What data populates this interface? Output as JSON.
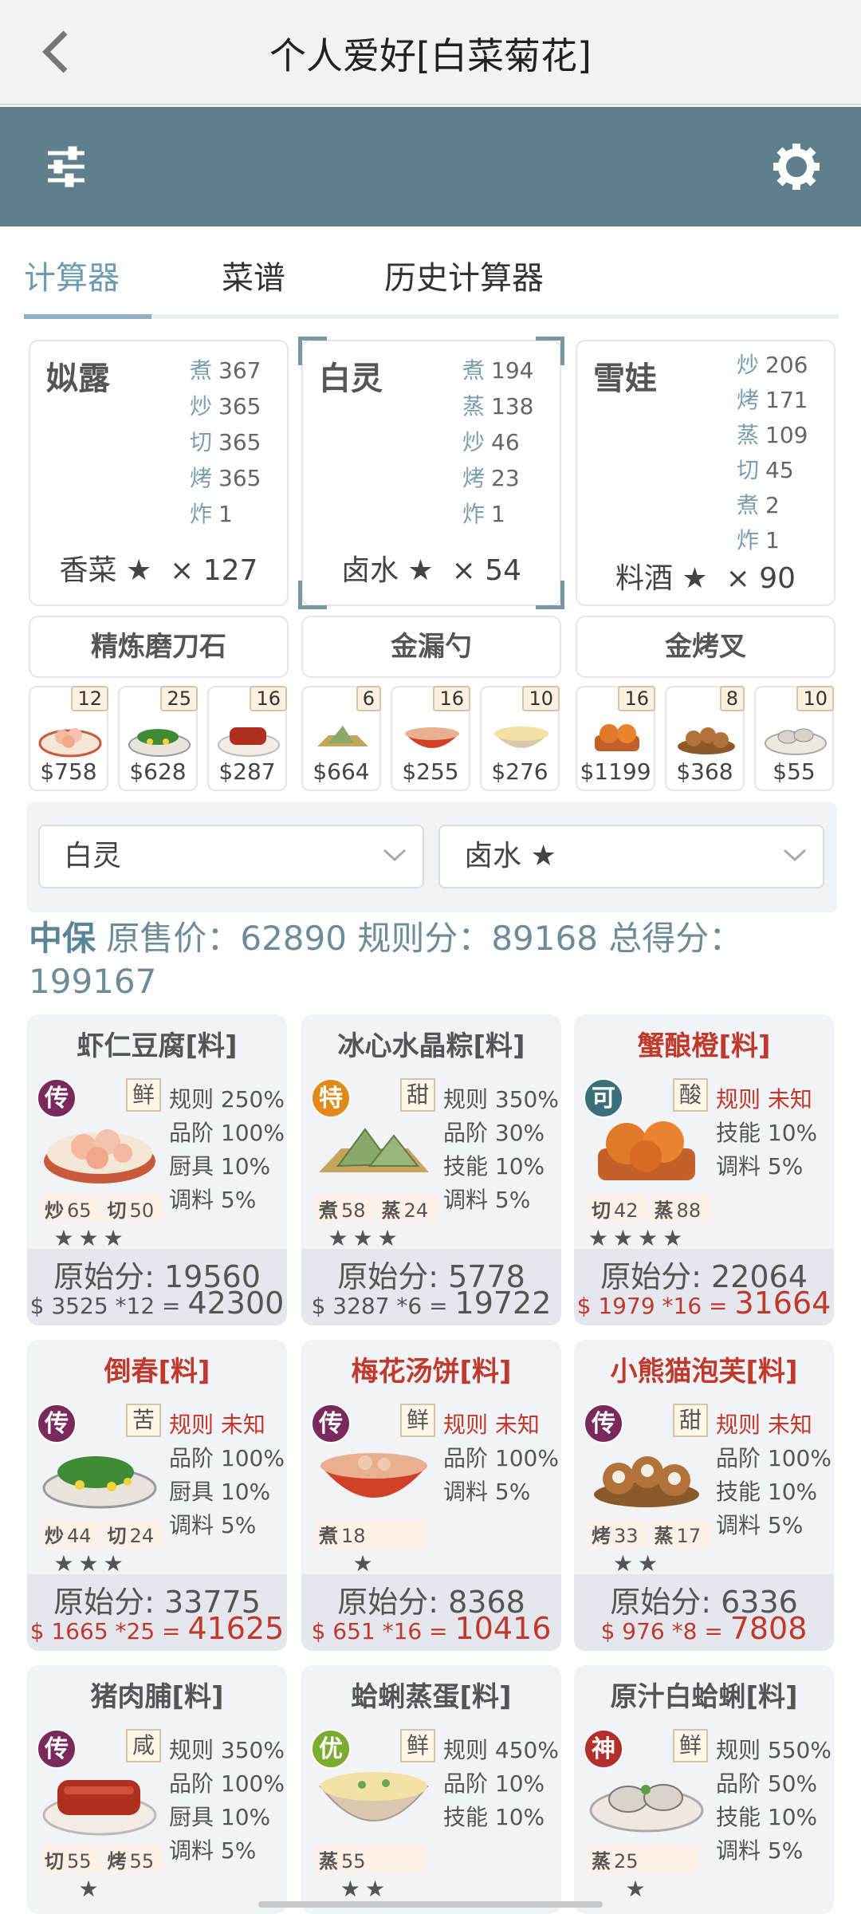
{
  "header": {
    "title": "个人爱好[白菜菊花]"
  },
  "tabs": [
    {
      "label": "计算器"
    },
    {
      "label": "菜谱"
    },
    {
      "label": "历史计算器"
    }
  ],
  "chefs": [
    {
      "name": "姒露",
      "skills": [
        {
          "k": "煮",
          "v": "367"
        },
        {
          "k": "炒",
          "v": "365"
        },
        {
          "k": "切",
          "v": "365"
        },
        {
          "k": "烤",
          "v": "365"
        },
        {
          "k": "炸",
          "v": "1"
        }
      ],
      "condiment": "香菜 ★",
      "count": "× 127"
    },
    {
      "name": "白灵",
      "skills": [
        {
          "k": "煮",
          "v": "194"
        },
        {
          "k": "蒸",
          "v": "138"
        },
        {
          "k": "炒",
          "v": "46"
        },
        {
          "k": "烤",
          "v": "23"
        },
        {
          "k": "炸",
          "v": "1"
        }
      ],
      "condiment": "卤水 ★",
      "count": "× 54"
    },
    {
      "name": "雪娃",
      "skills": [
        {
          "k": "炒",
          "v": "206"
        },
        {
          "k": "烤",
          "v": "171"
        },
        {
          "k": "蒸",
          "v": "109"
        },
        {
          "k": "切",
          "v": "45"
        },
        {
          "k": "煮",
          "v": "2"
        },
        {
          "k": "炸",
          "v": "1"
        }
      ],
      "condiment": "料酒 ★",
      "count": "× 90"
    }
  ],
  "equipment": [
    "精炼磨刀石",
    "金漏勺",
    "金烤叉"
  ],
  "recipes_strip": [
    {
      "qty": "12",
      "price": "$758"
    },
    {
      "qty": "25",
      "price": "$628"
    },
    {
      "qty": "16",
      "price": "$287"
    },
    {
      "qty": "6",
      "price": "$664"
    },
    {
      "qty": "16",
      "price": "$255"
    },
    {
      "qty": "10",
      "price": "$276"
    },
    {
      "qty": "16",
      "price": "$1199"
    },
    {
      "qty": "8",
      "price": "$368"
    },
    {
      "qty": "10",
      "price": "$55"
    }
  ],
  "selects": {
    "chef": "白灵",
    "condiment": "卤水 ★"
  },
  "summary": {
    "grade": "中保",
    "text": " 原售价：62890 规则分：89168 总得分：199167"
  },
  "cards": [
    {
      "name": "虾仁豆腐[料]",
      "rarity": "传",
      "flavor": "鲜",
      "stats": [
        "规则 250%",
        "品阶 100%",
        "厨具 10%",
        "调料 5%"
      ],
      "tags": [
        {
          "k": "炒",
          "v": "65"
        },
        {
          "k": "切",
          "v": "50"
        }
      ],
      "stars": "★★★",
      "orig": "原始分: 19560",
      "calc_small": "$ 3525 *12 =",
      "calc_big": "42300"
    },
    {
      "name": "冰心水晶粽[料]",
      "rarity": "特",
      "flavor": "甜",
      "stats": [
        "规则 350%",
        "品阶 30%",
        "技能 10%",
        "调料 5%"
      ],
      "tags": [
        {
          "k": "煮",
          "v": "58"
        },
        {
          "k": "蒸",
          "v": "24"
        }
      ],
      "stars": "★★★",
      "orig": "原始分: 5778",
      "calc_small": "$ 3287 *6 =",
      "calc_big": "19722"
    },
    {
      "name": "蟹酿橙[料]",
      "rarity": "可",
      "flavor": "酸",
      "stats": [
        "规则 未知",
        "技能 10%",
        "调料 5%"
      ],
      "tags": [
        {
          "k": "切",
          "v": "42"
        },
        {
          "k": "蒸",
          "v": "88"
        }
      ],
      "stars": "★★★★",
      "orig": "原始分: 22064",
      "calc_small": "$ 1979 *16 =",
      "calc_big": "31664"
    },
    {
      "name": "倒春[料]",
      "rarity": "传",
      "flavor": "苦",
      "stats": [
        "规则 未知",
        "品阶 100%",
        "厨具 10%",
        "调料 5%"
      ],
      "tags": [
        {
          "k": "炒",
          "v": "44"
        },
        {
          "k": "切",
          "v": "24"
        }
      ],
      "stars": "★★★",
      "orig": "原始分: 33775",
      "calc_small": "$ 1665 *25 =",
      "calc_big": "41625"
    },
    {
      "name": "梅花汤饼[料]",
      "rarity": "传",
      "flavor": "鲜",
      "stats": [
        "规则 未知",
        "品阶 100%",
        "调料 5%"
      ],
      "tags": [
        {
          "k": "煮",
          "v": "18"
        }
      ],
      "stars": "★",
      "orig": "原始分: 8368",
      "calc_small": "$ 651 *16 =",
      "calc_big": "10416"
    },
    {
      "name": "小熊猫泡芙[料]",
      "rarity": "传",
      "flavor": "甜",
      "stats": [
        "规则 未知",
        "品阶 100%",
        "技能 10%",
        "调料 5%"
      ],
      "tags": [
        {
          "k": "烤",
          "v": "33"
        },
        {
          "k": "蒸",
          "v": "17"
        }
      ],
      "stars": "★★",
      "orig": "原始分: 6336",
      "calc_small": "$ 976 *8 =",
      "calc_big": "7808"
    },
    {
      "name": "猪肉脯[料]",
      "rarity": "传",
      "flavor": "咸",
      "stats": [
        "规则 350%",
        "品阶 100%",
        "厨具 10%",
        "调料 5%"
      ],
      "tags": [
        {
          "k": "切",
          "v": "55"
        },
        {
          "k": "烤",
          "v": "55"
        }
      ],
      "stars": "★",
      "orig": "",
      "calc_small": "",
      "calc_big": ""
    },
    {
      "name": "蛤蜊蒸蛋[料]",
      "rarity": "优",
      "flavor": "鲜",
      "stats": [
        "规则 450%",
        "品阶 10%",
        "技能 10%"
      ],
      "tags": [
        {
          "k": "蒸",
          "v": "55"
        }
      ],
      "stars": "★★",
      "orig": "",
      "calc_small": "",
      "calc_big": ""
    },
    {
      "name": "原汁白蛤蜊[料]",
      "rarity": "神",
      "flavor": "鲜",
      "stats": [
        "规则 550%",
        "品阶 50%",
        "技能 10%",
        "调料 5%"
      ],
      "tags": [
        {
          "k": "蒸",
          "v": "25"
        }
      ],
      "stars": "★",
      "orig": "",
      "calc_small": "",
      "calc_big": ""
    }
  ],
  "colors": {
    "toolbar": "#5f7f8c",
    "accent": "#6d9bb3",
    "red": "#c0392b",
    "rarity_chuan": "#7a2a5a",
    "rarity_te": "#e08a1e",
    "rarity_ke": "#3d6f7a",
    "rarity_you": "#7bab2f",
    "rarity_shen": "#b3302a"
  }
}
